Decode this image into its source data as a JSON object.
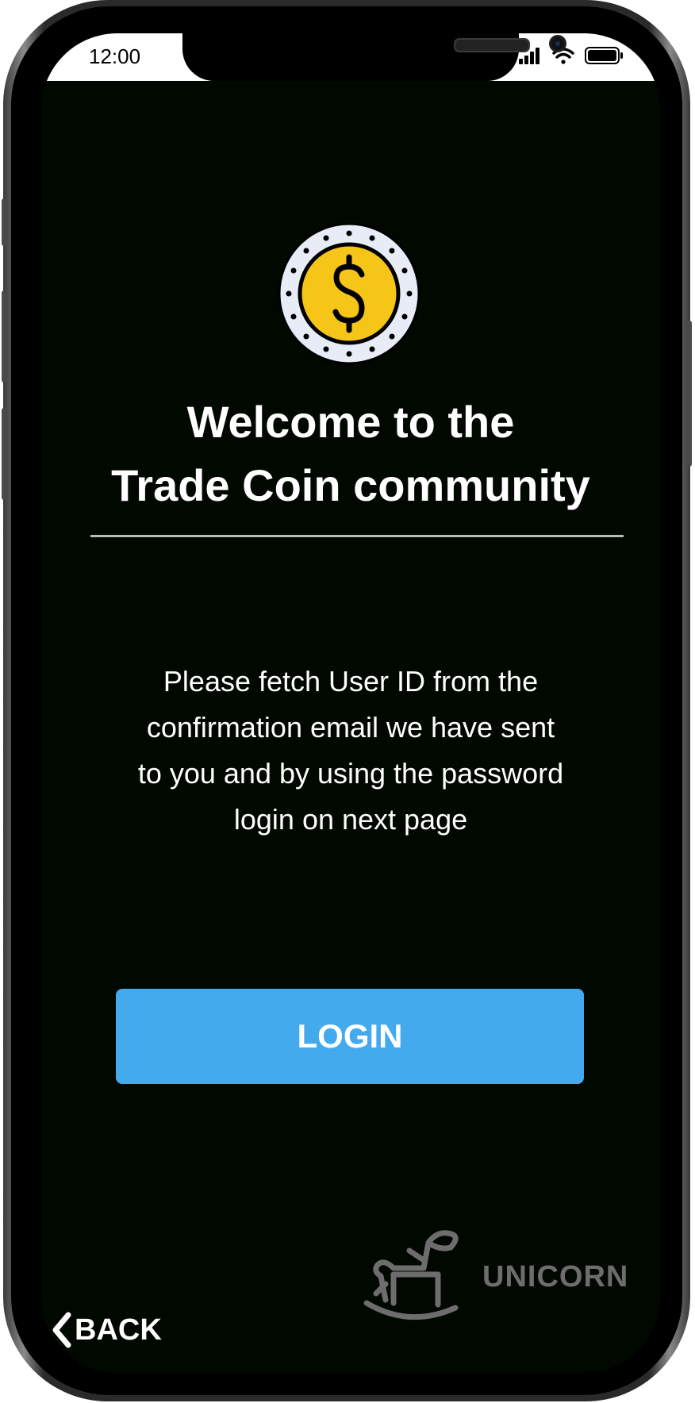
{
  "status_bar": {
    "time": "12:00",
    "signal_icon": "cellular-signal-icon",
    "wifi_icon": "wifi-icon",
    "battery_icon": "battery-icon"
  },
  "logo": {
    "icon": "dollar-coin-icon",
    "colors": {
      "coin_fill": "#f5c518",
      "rim": "#e8ecf6",
      "outline": "#000000"
    }
  },
  "welcome": {
    "line1": "Welcome to the",
    "line2": "Trade Coin community"
  },
  "message": {
    "line1": "Please fetch User ID from the",
    "line2": "confirmation email we have sent",
    "line3": "to you and by using the password",
    "line4": "login on next page"
  },
  "login_button": {
    "label": "LOGIN",
    "color": "#44aaee"
  },
  "brand": {
    "icon": "rocking-horse-icon",
    "name": "UNICORN",
    "color": "#6d6d6d"
  },
  "back_button": {
    "icon": "chevron-left-icon",
    "label": "BACK"
  },
  "theme": {
    "background": "#010800",
    "text": "#ffffff"
  }
}
